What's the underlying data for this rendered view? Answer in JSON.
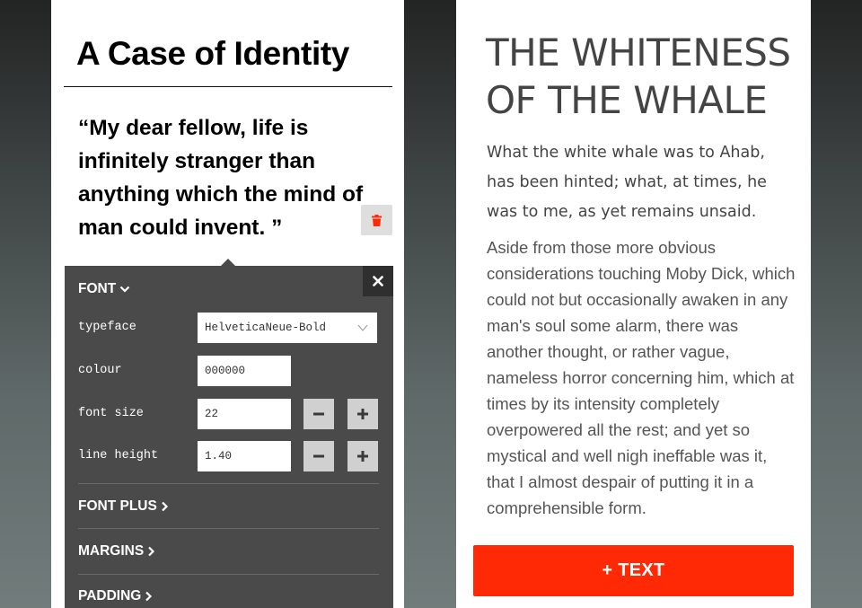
{
  "left_card": {
    "title": "A Case of Identity",
    "quote": "“My dear fellow, life is infinitely stranger than anything which the mind of man could invent. ”"
  },
  "panel": {
    "font_section": "FONT",
    "typeface_label": "typeface",
    "typeface_value": "HelveticaNeue-Bold",
    "colour_label": "colour",
    "colour_value": "000000",
    "font_size_label": "font size",
    "font_size_value": "22",
    "line_height_label": "line height",
    "line_height_value": "1.40",
    "font_plus_section": "FONT PLUS",
    "margins_section": "MARGINS",
    "padding_section": "PADDING"
  },
  "right_card": {
    "title": "THE WHITENESS OF THE WHALE",
    "lede": "What the white whale was to Ahab, has been hinted; what, at times, he was to me, as yet remains unsaid.",
    "body": "Aside from those more obvious considerations touching Moby Dick, which could not but occasionally awaken in any man's soul some alarm, there was another thought, or rather vague, nameless horror concerning him, which at times by its intensity completely overpowered all the rest; and yet so mystical and well nigh ineffable was it, that I almost despair of putting it in a comprehensible form.",
    "add_button": "+ TEXT"
  },
  "colors": {
    "accent": "#ff2a05",
    "panel_bg": "#4a4a4a",
    "trash_icon": "#ff2a05"
  },
  "icons": {
    "trash": "trash-icon",
    "close": "close-icon",
    "chevron_down": "chevron-down-icon",
    "chevron_right": "chevron-right-icon",
    "minus": "minus-icon",
    "plus": "plus-icon"
  }
}
